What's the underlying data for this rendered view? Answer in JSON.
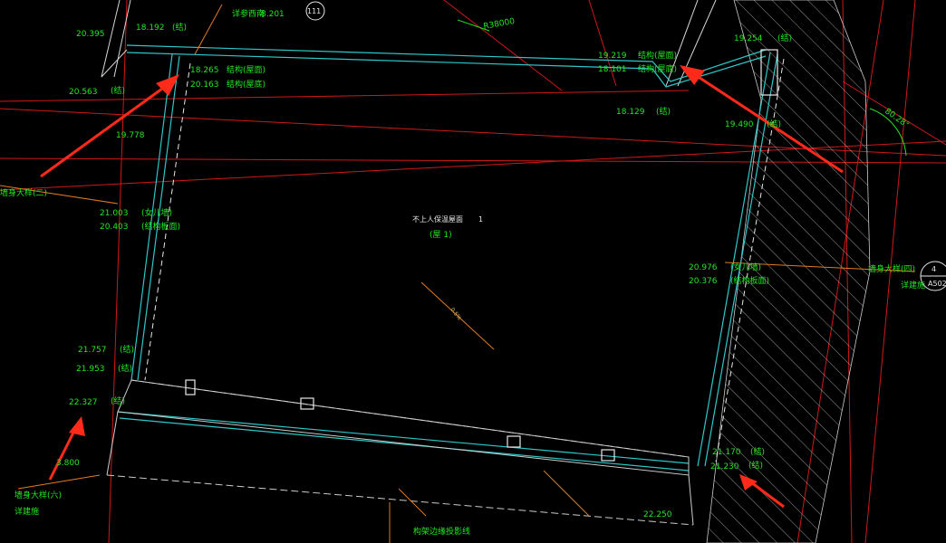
{
  "colors": {
    "background": "#000000",
    "wall_cyan": "#2ec8c8",
    "label_green": "#22e622",
    "grid_red": "#d01818",
    "annotation_arrow": "#ff2a1a",
    "leader_orange": "#e07a20"
  },
  "labels": {
    "top_left_ref": "详参西南",
    "top_left_ref_num": "8.201",
    "top_left_circle": "111",
    "radius": "R38000",
    "angle": "80.28°",
    "room_name": "不上人保温屋面",
    "room_num": "1",
    "room_sub": "(屋 1)",
    "slope": "0.5%",
    "right_detail_title": "墙身大样(四)",
    "right_detail_ref": "详建施",
    "right_detail_circle_top": "4",
    "right_detail_circle_bottom": "A502",
    "left_detail_title": "墙身大样(六)",
    "left_detail_ref": "详建施",
    "left_detail_cut": "墙身大样(二)",
    "bottom_note": "构架边缘投影线"
  },
  "elevations": {
    "e20395": "20.395",
    "e18192": "18.192",
    "e20563": "20.563",
    "e18265": "18.265",
    "e20163": "20.163",
    "e19778": "19.778",
    "e21003": "21.003",
    "e20403": "20.403",
    "e21757": "21.757",
    "e21953": "21.953",
    "e22327": "22.327",
    "e3800": "3.800",
    "e19219": "19.219",
    "e18101": "18.101",
    "e18129": "18.129",
    "e19254": "19.254",
    "e19490": "19.490",
    "e20976": "20.976",
    "e20376": "20.376",
    "e21170": "21.170",
    "e21230": "21.230",
    "e22250": "22.250"
  },
  "tags": {
    "struct": "(结)",
    "struct_top": "结构(屋面)",
    "struct_bottom": "结构(屋底)",
    "beam_top": "(结构板面)",
    "top_wall": "(女儿墙)"
  }
}
